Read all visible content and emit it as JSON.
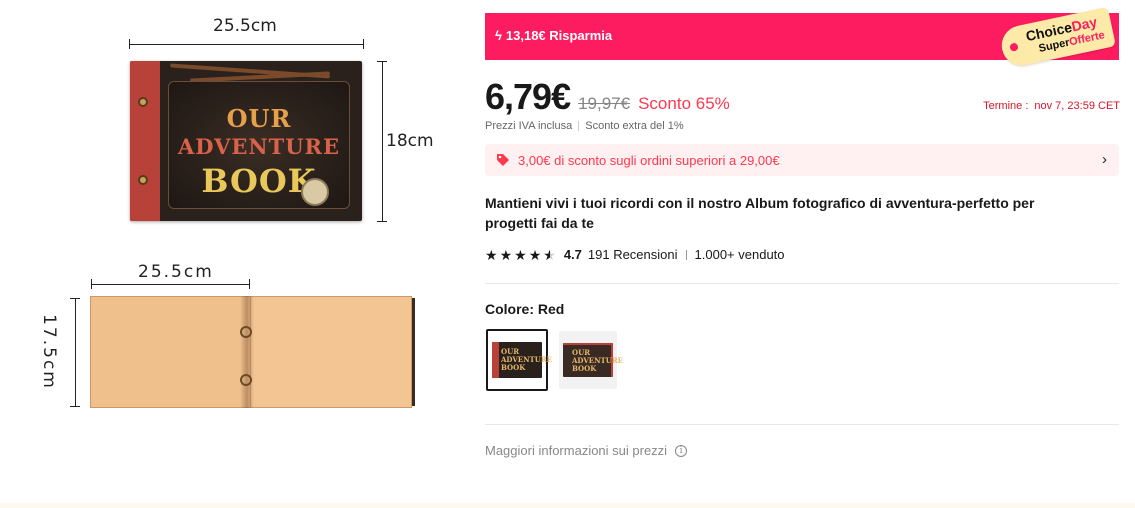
{
  "product_image": {
    "dim_top_width": "25.5cm",
    "dim_top_height": "18cm",
    "dim_bottom_width": "25.5cm",
    "dim_bottom_height": "17.5cm",
    "cover_title": [
      "OUR",
      "ADVENTURE",
      "BOOK"
    ]
  },
  "promo": {
    "savings_text": "13,18€ Risparmia",
    "choice_day_line1a": "Choice",
    "choice_day_line1b": "Day",
    "choice_day_line2a": "Super",
    "choice_day_line2b": "Offerte",
    "accent_color": "#fd1c5f"
  },
  "price": {
    "current": "6,79€",
    "original": "19,97€",
    "discount": "Sconto 65%",
    "deadline_label": "Termine :",
    "deadline_value": "nov 7, 23:59 CET",
    "tax_note": "Prezzi IVA inclusa",
    "extra_discount": "Sconto extra del 1%"
  },
  "coupon": {
    "icon": "tag-icon",
    "text": "3,00€ di sconto sugli ordini superiori a 29,00€"
  },
  "product": {
    "title": "Mantieni vivi i tuoi ricordi con il nostro Album fotografico di avventura-perfetto per progetti fai da te",
    "rating": "4.7",
    "reviews": "191 Recensioni",
    "sold": "1.000+ venduto"
  },
  "color": {
    "label": "Colore: Red",
    "options": [
      {
        "selected": true,
        "title_mini": "OUR ADVENTURE BOOK"
      },
      {
        "selected": false,
        "title_mini": "OUR ADVENTURE BOOK"
      }
    ]
  },
  "footer": {
    "more_info": "Maggiori informazioni sui prezzi"
  }
}
